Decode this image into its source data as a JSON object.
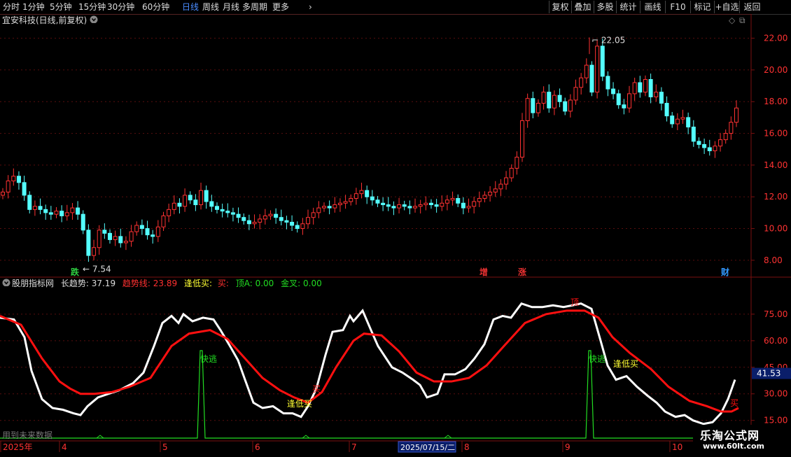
{
  "toolbar": {
    "periods": [
      "分时",
      "1分钟",
      "5分钟",
      "15分钟",
      "30分钟",
      "60分钟",
      "日线",
      "周线",
      "月线",
      "多周期",
      "更多"
    ],
    "active_period": "日线",
    "right_buttons": [
      "复权",
      "叠加",
      "多股",
      "统计",
      "画线",
      "F10",
      "标记",
      "+自选",
      "返回"
    ]
  },
  "main_chart": {
    "title": "宜安科技(日线,前复权)",
    "high_label": "22.05",
    "low_label": "7.54",
    "price_ticks": [
      "22.00",
      "20.00",
      "18.00",
      "16.00",
      "14.00",
      "12.00",
      "10.00",
      "8.00"
    ],
    "event_badges": [
      {
        "text": "跌",
        "color": "#2ecc40"
      },
      {
        "text": "增",
        "color": "#e83030"
      },
      {
        "text": "涨",
        "color": "#e83030"
      },
      {
        "text": "财",
        "color": "#3399ff"
      }
    ]
  },
  "indicator": {
    "name": "股朋指标网",
    "long_trend_label": "长趋势:",
    "long_trend_value": "37.19",
    "trend_line_label": "趋势线:",
    "trend_line_value": "23.89",
    "dip_buy_label": "逢低买:",
    "buy_label": "买:",
    "top_label": "顶A:",
    "top_value": "0.00",
    "golden_cross_label": "金叉:",
    "golden_cross_value": "0.00",
    "ticks": [
      "75.00",
      "60.00",
      "45.00",
      "30.00",
      "15.00"
    ],
    "current_value": "41.53",
    "annotations": {
      "fast_escape": "快逃",
      "dip_buy": "逢低买",
      "buy": "买",
      "top": "顶"
    },
    "future_data_note": "用到未来数据"
  },
  "x_axis": {
    "labels": [
      "2025年",
      "4",
      "5",
      "6",
      "7",
      "8",
      "9",
      "10"
    ],
    "cursor_date": "2025/07/15/二"
  },
  "watermark": {
    "name": "乐淘公式网",
    "url": "www.60lt.com"
  },
  "colors": {
    "up": "#ff3232",
    "down": "#54ffff",
    "white_line": "#ffffff",
    "red_line": "#ff1010",
    "green": "#22dd22",
    "axis": "#7a1010"
  },
  "chart_data": [
    {
      "type": "candlestick",
      "title": "宜安科技(日线,前复权)",
      "ylim": [
        7.2,
        22.6
      ],
      "high": 22.05,
      "low": 7.54,
      "closes": [
        12.3,
        13.0,
        13.3,
        12.9,
        12.1,
        11.2,
        11.4,
        11.2,
        11.0,
        10.9,
        11.1,
        10.8,
        11.0,
        11.3,
        10.9,
        9.9,
        8.3,
        8.8,
        9.9,
        9.7,
        9.3,
        9.5,
        9.1,
        9.2,
        9.8,
        10.2,
        10.0,
        9.6,
        9.5,
        10.1,
        10.8,
        11.2,
        11.6,
        11.4,
        12.1,
        11.8,
        11.5,
        12.4,
        11.7,
        11.4,
        11.2,
        11.1,
        11.0,
        10.9,
        10.7,
        10.5,
        10.3,
        10.4,
        10.6,
        10.8,
        10.9,
        10.7,
        10.5,
        10.4,
        10.2,
        10.0,
        10.3,
        10.7,
        11.0,
        11.3,
        11.4,
        11.3,
        11.5,
        11.6,
        11.7,
        11.9,
        12.2,
        12.4,
        12.0,
        11.8,
        11.6,
        11.5,
        11.4,
        11.3,
        11.5,
        11.4,
        11.3,
        11.4,
        11.5,
        11.6,
        11.5,
        11.4,
        11.6,
        11.8,
        11.9,
        11.6,
        11.3,
        11.4,
        11.7,
        11.9,
        12.1,
        12.3,
        12.5,
        12.8,
        13.2,
        13.8,
        14.5,
        16.8,
        18.2,
        17.3,
        17.9,
        18.6,
        17.6,
        18.4,
        18.0,
        17.4,
        18.1,
        18.9,
        19.5,
        20.3,
        18.6,
        21.5,
        19.6,
        18.8,
        18.5,
        17.8,
        17.6,
        18.5,
        19.2,
        18.6,
        19.4,
        18.3,
        18.6,
        17.9,
        17.1,
        16.6,
        16.9,
        17.0,
        16.4,
        15.5,
        15.3,
        15.1,
        14.9,
        15.2,
        15.6,
        16.0,
        16.7,
        17.6
      ]
    },
    {
      "type": "line",
      "name": "股朋指标网",
      "ylim": [
        5,
        88
      ],
      "series": [
        {
          "name": "长趋势",
          "last": 37.19
        },
        {
          "name": "趋势线",
          "last": 23.89
        }
      ],
      "current_value": 41.53
    }
  ]
}
